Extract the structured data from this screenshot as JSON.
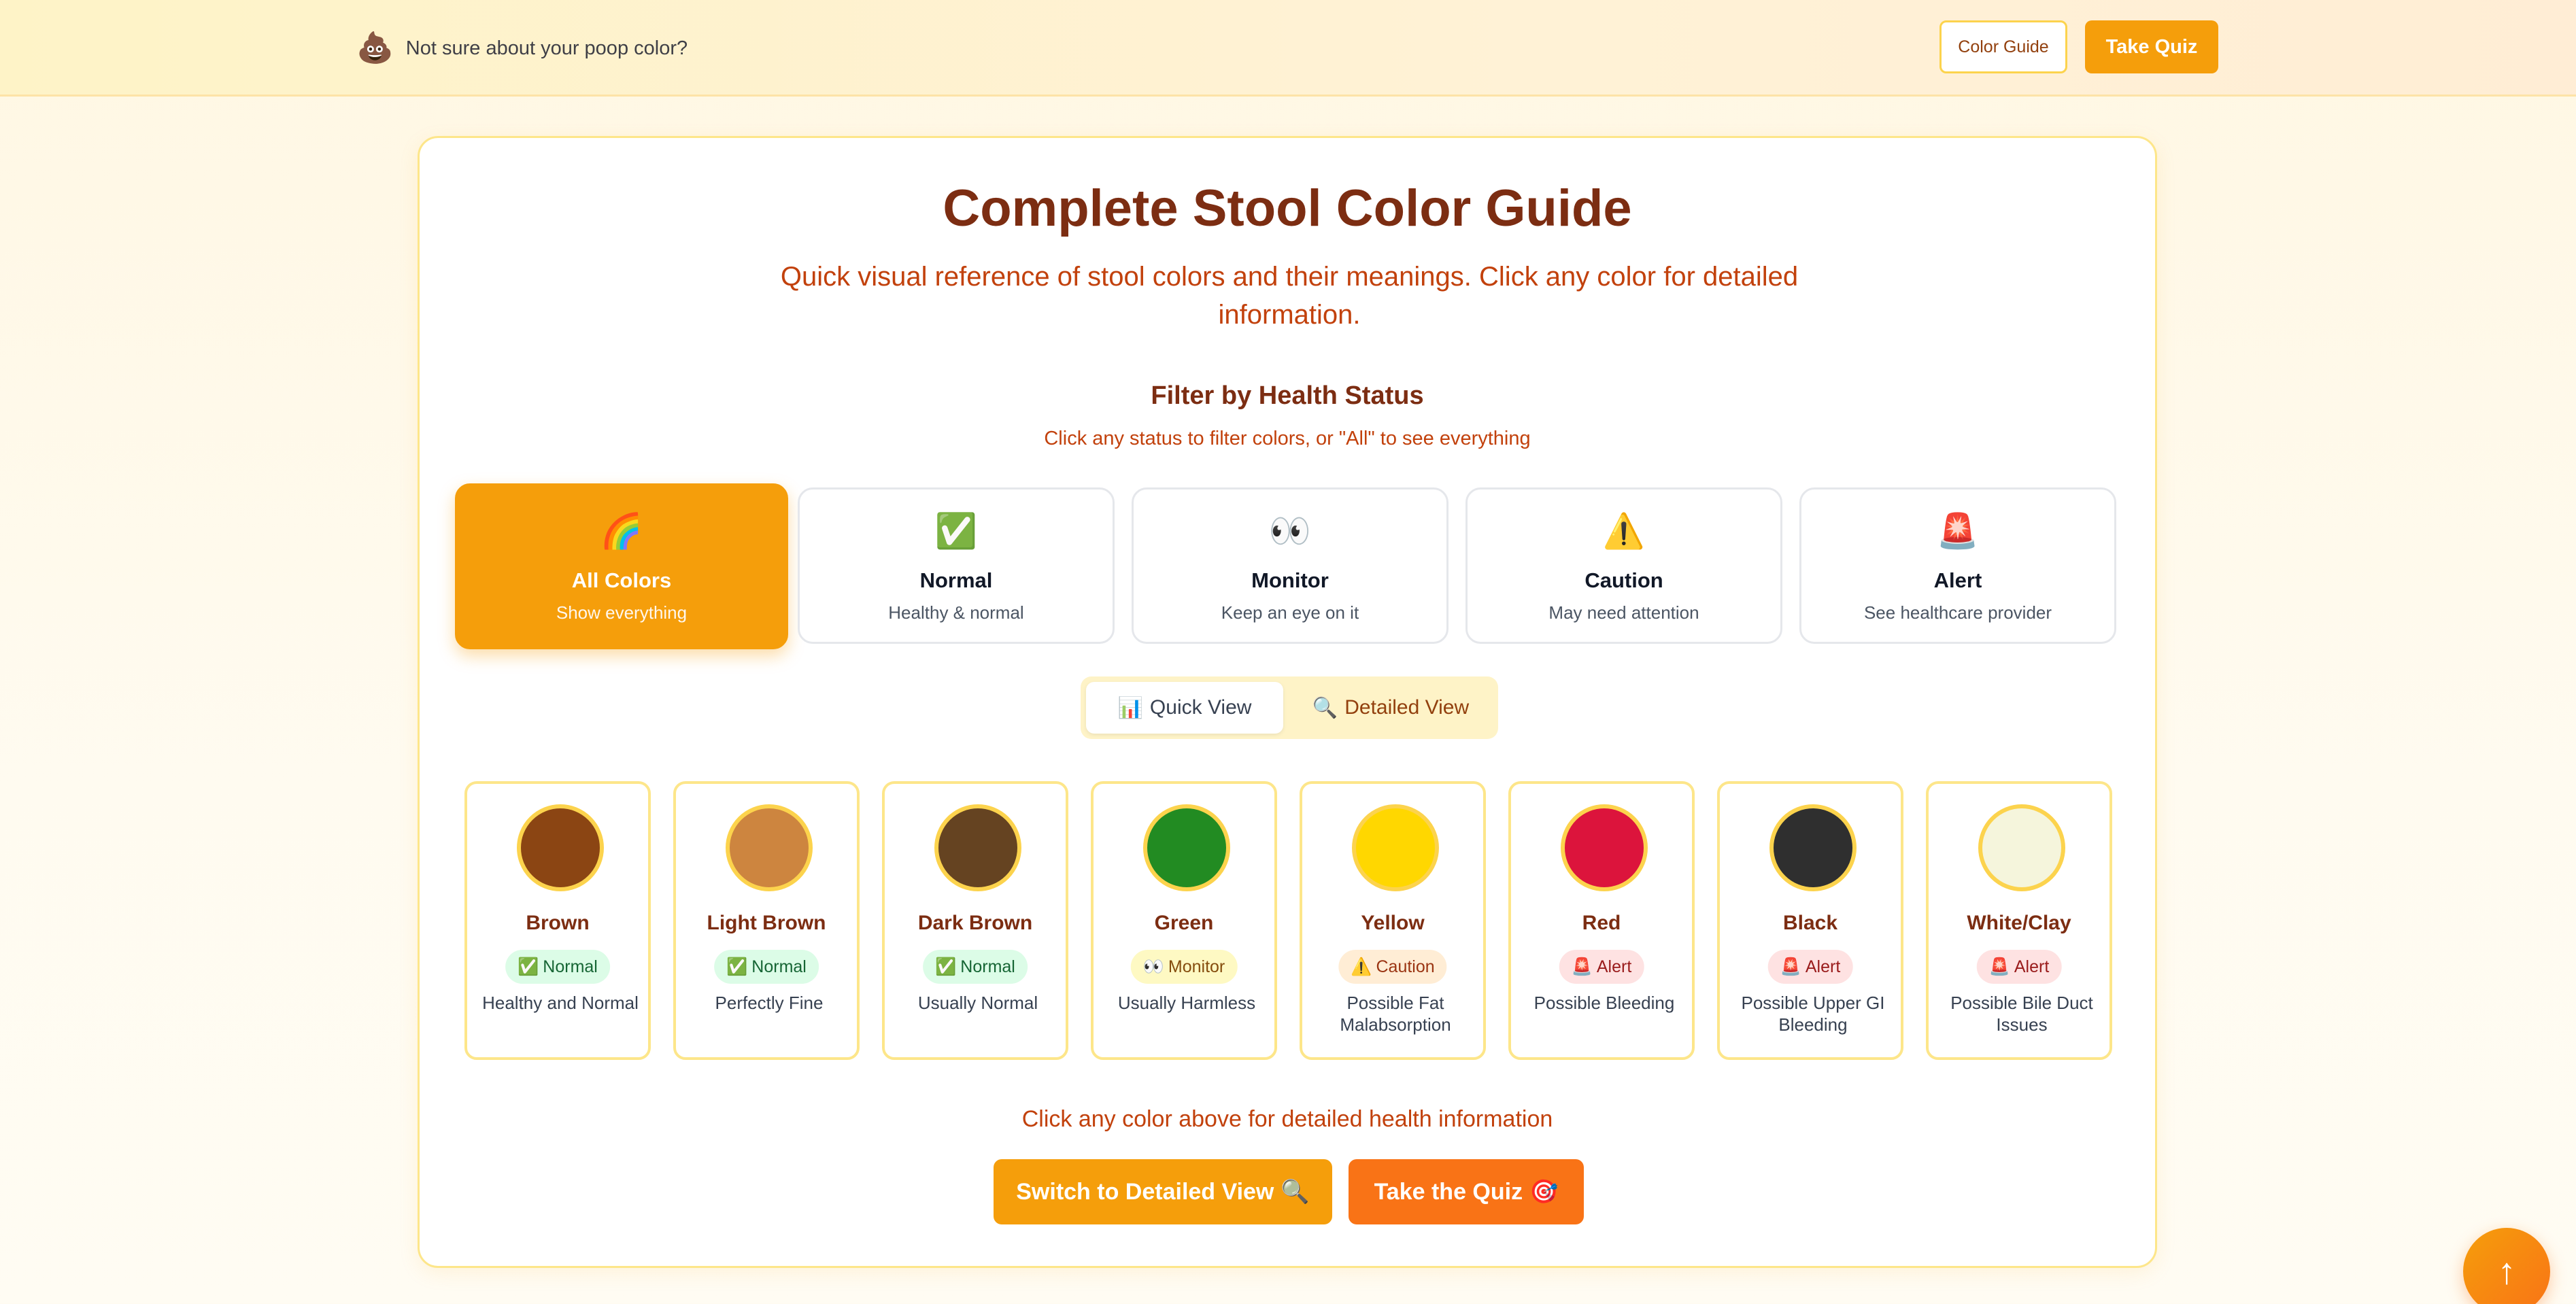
{
  "banner": {
    "emoji": "💩",
    "question": "Not sure about your poop color?",
    "guide_button": "Color Guide",
    "quiz_button": "Take Quiz"
  },
  "main": {
    "title": "Complete Stool Color Guide",
    "subtitle": "Quick visual reference of stool colors and their meanings. Click any color for detailed information.",
    "filter_title": "Filter by Health Status",
    "filter_hint": "Click any status to filter colors, or \"All\" to see everything",
    "filters": [
      {
        "icon": "🌈",
        "name": "All Colors",
        "desc": "Show everything",
        "active": true
      },
      {
        "icon": "✅",
        "name": "Normal",
        "desc": "Healthy & normal"
      },
      {
        "icon": "👀",
        "name": "Monitor",
        "desc": "Keep an eye on it"
      },
      {
        "icon": "⚠️",
        "name": "Caution",
        "desc": "May need attention"
      },
      {
        "icon": "🚨",
        "name": "Alert",
        "desc": "See healthcare provider"
      }
    ],
    "view_toggle": {
      "quick_icon": "📊",
      "quick_label": "Quick View",
      "detailed_icon": "🔍",
      "detailed_label": "Detailed View",
      "selected": "Quick View"
    },
    "colors": [
      {
        "name": "Brown",
        "hex": "#8B4513",
        "status": "Normal",
        "status_icon": "✅",
        "status_type": "normal",
        "desc": "Healthy and Normal"
      },
      {
        "name": "Light Brown",
        "hex": "#CD853F",
        "status": "Normal",
        "status_icon": "✅",
        "status_type": "normal",
        "desc": "Perfectly Fine"
      },
      {
        "name": "Dark Brown",
        "hex": "#654321",
        "status": "Normal",
        "status_icon": "✅",
        "status_type": "normal",
        "desc": "Usually Normal"
      },
      {
        "name": "Green",
        "hex": "#228B22",
        "status": "Monitor",
        "status_icon": "👀",
        "status_type": "monitor",
        "desc": "Usually Harmless"
      },
      {
        "name": "Yellow",
        "hex": "#FFD700",
        "status": "Caution",
        "status_icon": "⚠️",
        "status_type": "caution",
        "desc": "Possible Fat Malabsorption"
      },
      {
        "name": "Red",
        "hex": "#DC143C",
        "status": "Alert",
        "status_icon": "🚨",
        "status_type": "alert",
        "desc": "Possible Bleeding"
      },
      {
        "name": "Black",
        "hex": "#2F2F2F",
        "status": "Alert",
        "status_icon": "🚨",
        "status_type": "alert",
        "desc": "Possible Upper GI Bleeding"
      },
      {
        "name": "White/Clay",
        "hex": "#F5F5DC",
        "status": "Alert",
        "status_icon": "🚨",
        "status_type": "alert",
        "desc": "Possible Bile Duct Issues"
      }
    ],
    "bottom_hint": "Click any color above for detailed health information",
    "detailed_button": "Switch to Detailed View",
    "detailed_button_icon": "🔍",
    "quiz_button": "Take the Quiz",
    "quiz_button_icon": "🎯"
  },
  "scroll_top": {
    "icon": "arrow-up-icon",
    "glyph": "↑"
  },
  "theme": {
    "accent": "#F59E0B",
    "accent_dark": "#F97316",
    "title_color": "#7C2D12",
    "text_orange": "#C2410C"
  }
}
